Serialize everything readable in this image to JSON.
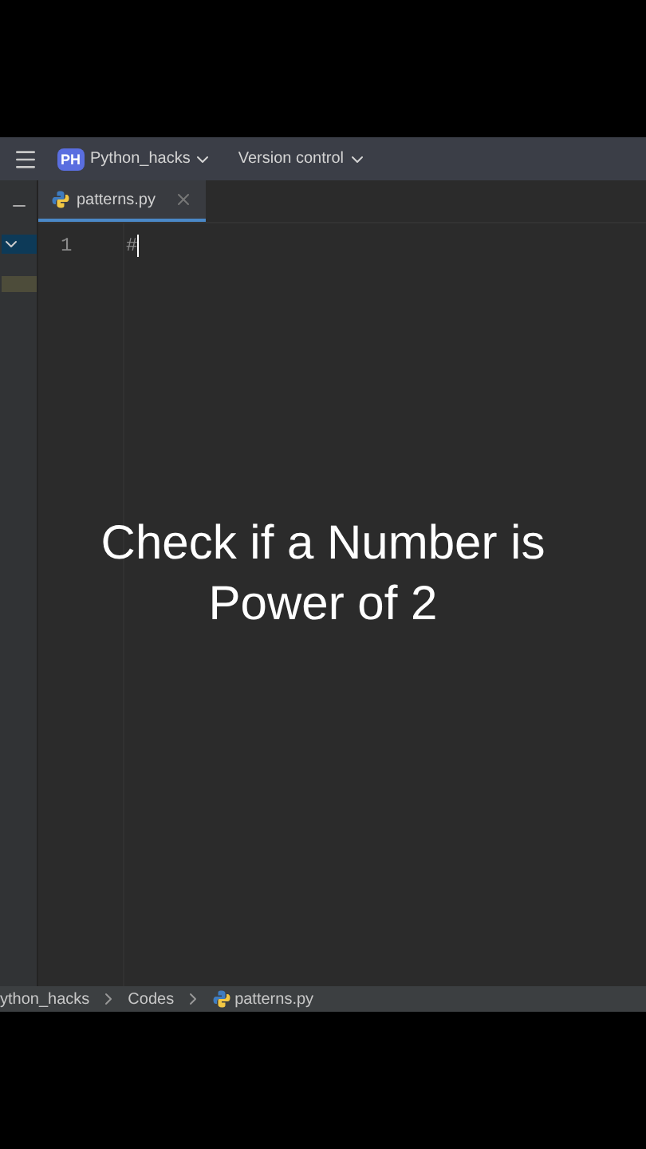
{
  "header": {
    "project_badge": "PH",
    "project": "Python_hacks",
    "vcs": "Version control"
  },
  "tabs": [
    {
      "label": "patterns.py",
      "selected": true
    }
  ],
  "editor": {
    "lines": [
      {
        "number": "1",
        "code": "#"
      }
    ]
  },
  "caption": [
    "Check if a Number is",
    "Power of 2"
  ],
  "breadcrumbs": [
    {
      "label": "ython_hacks",
      "file": false
    },
    {
      "label": "Codes",
      "file": false
    },
    {
      "label": "patterns.py",
      "file": true
    }
  ]
}
